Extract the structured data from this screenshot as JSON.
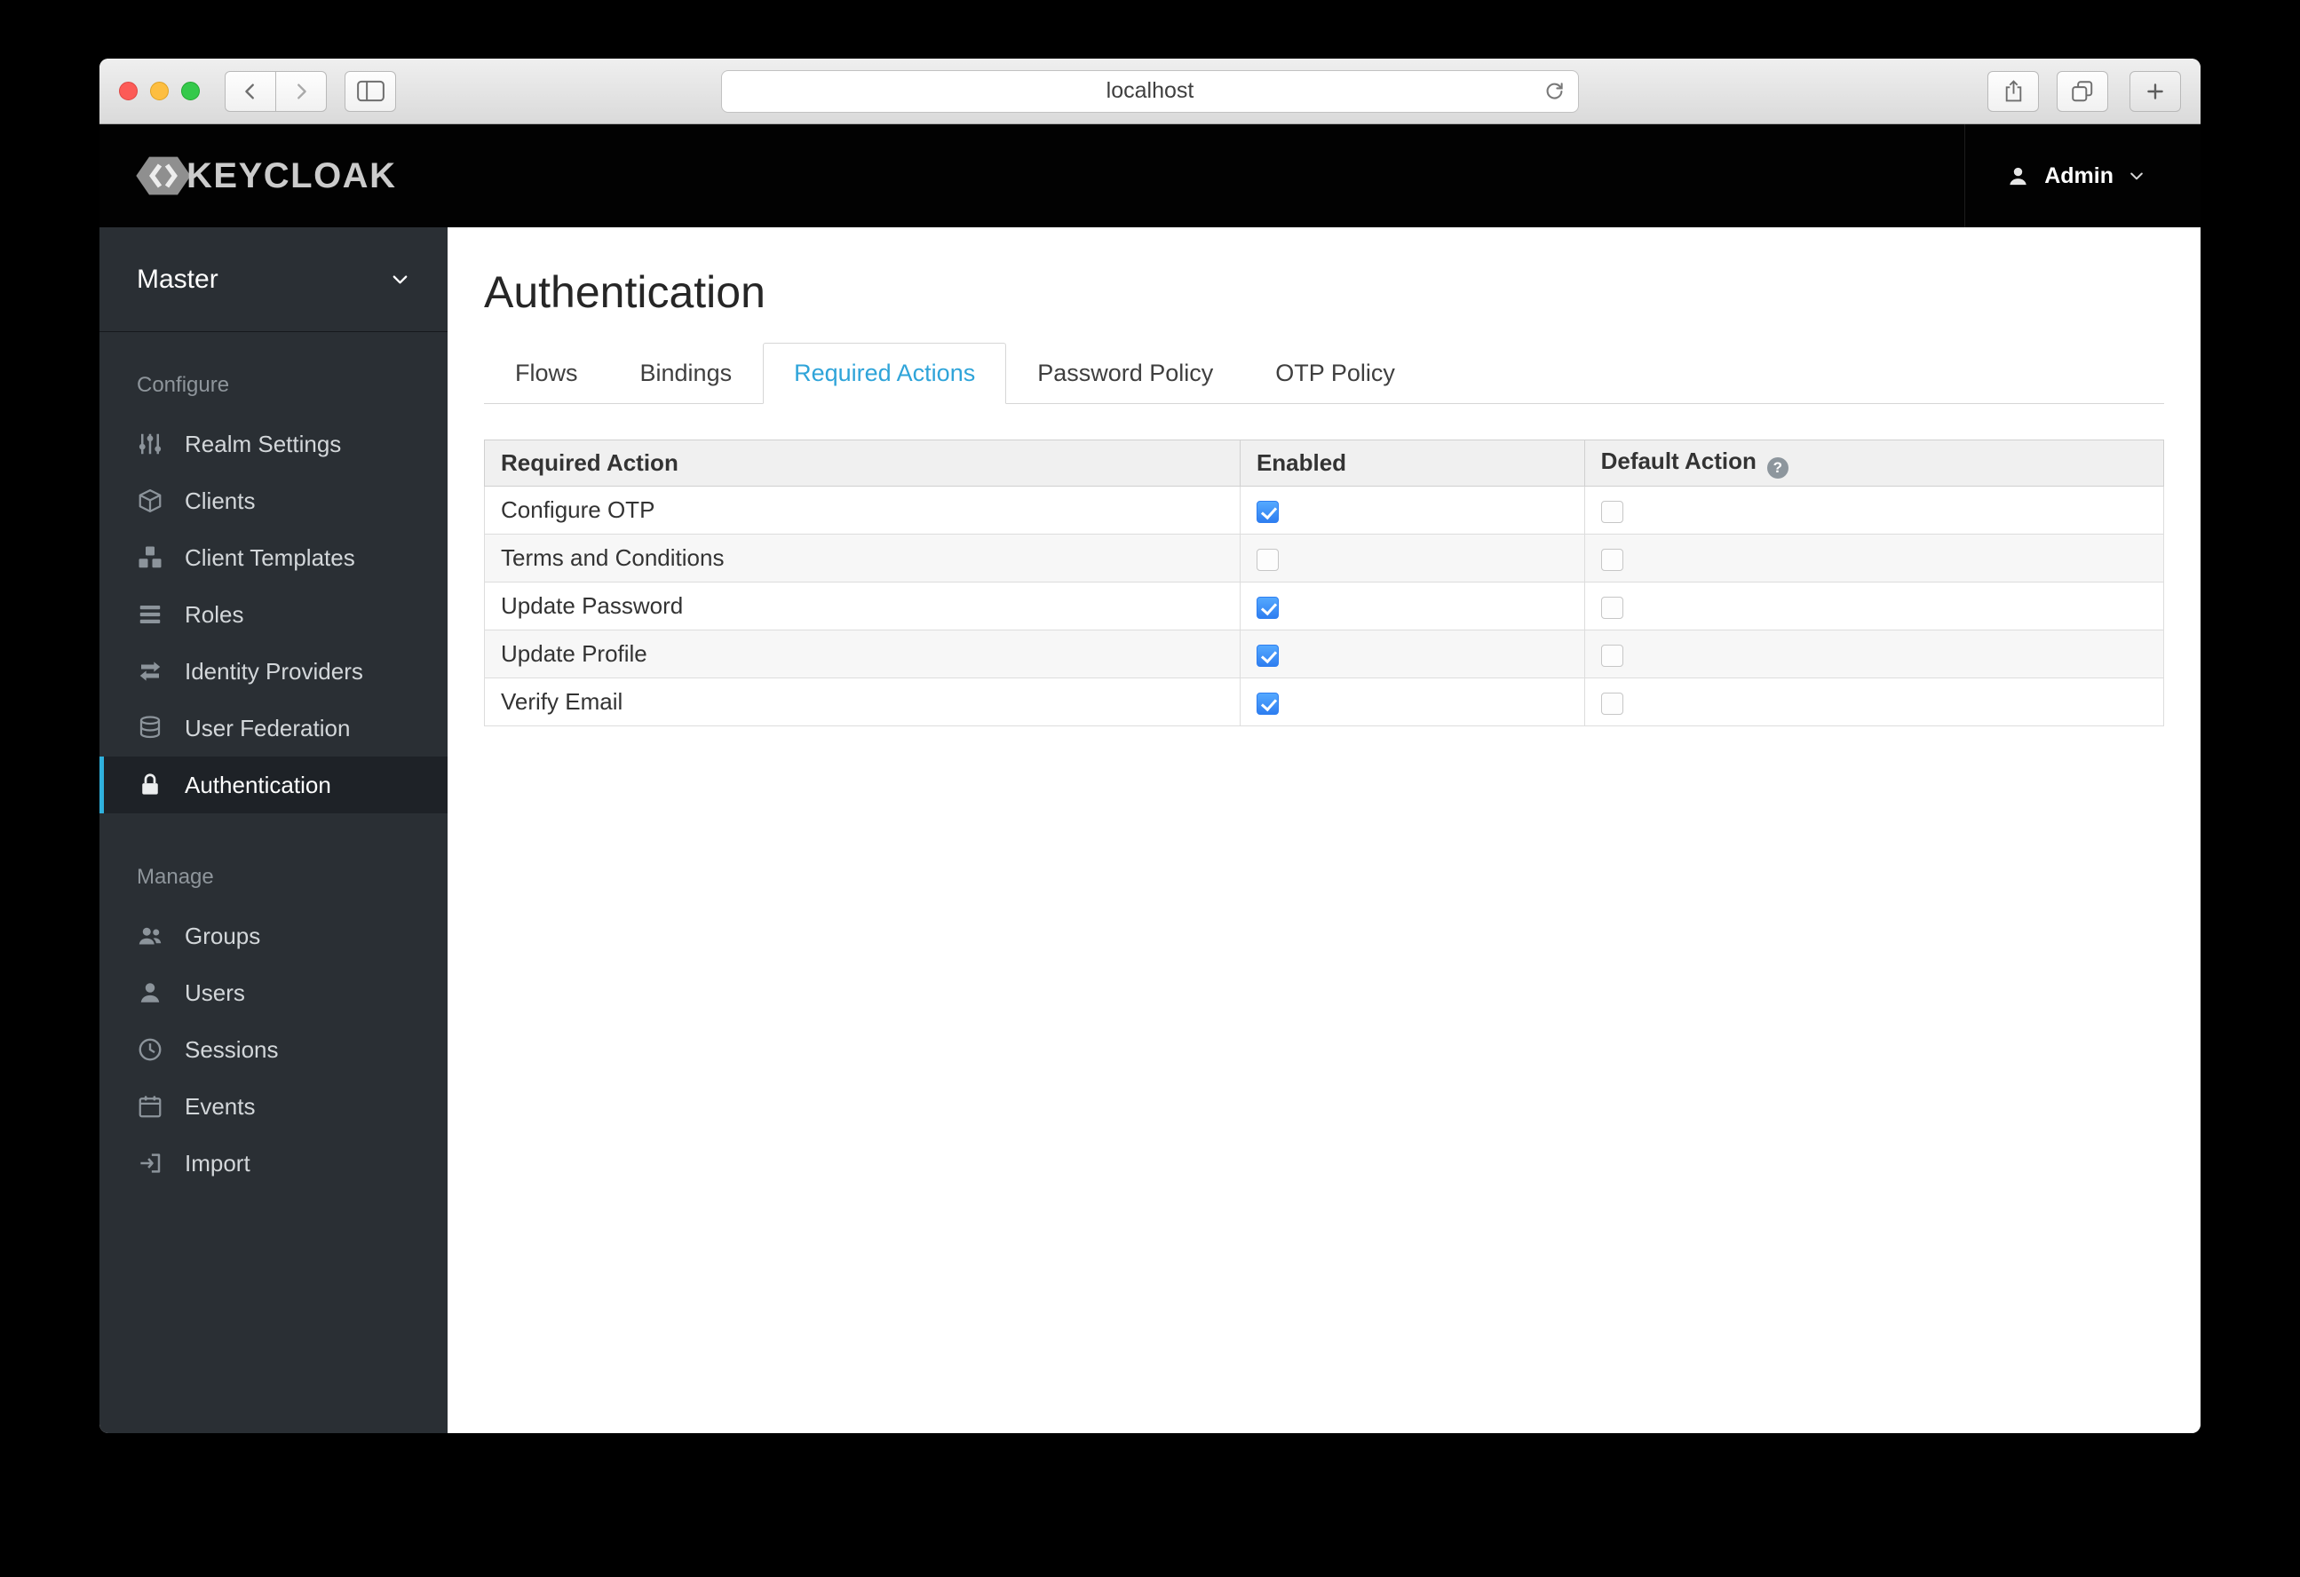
{
  "browser": {
    "address": "localhost"
  },
  "navbar": {
    "brand": "KEYCLOAK",
    "user": "Admin"
  },
  "sidebar": {
    "realm": "Master",
    "sections": [
      {
        "label": "Configure",
        "items": [
          {
            "label": "Realm Settings",
            "icon": "sliders-icon",
            "active": false
          },
          {
            "label": "Clients",
            "icon": "cube-icon",
            "active": false
          },
          {
            "label": "Client Templates",
            "icon": "cubes-icon",
            "active": false
          },
          {
            "label": "Roles",
            "icon": "list-icon",
            "active": false
          },
          {
            "label": "Identity Providers",
            "icon": "exchange-icon",
            "active": false
          },
          {
            "label": "User Federation",
            "icon": "database-icon",
            "active": false
          },
          {
            "label": "Authentication",
            "icon": "lock-icon",
            "active": true
          }
        ]
      },
      {
        "label": "Manage",
        "items": [
          {
            "label": "Groups",
            "icon": "groups-icon",
            "active": false
          },
          {
            "label": "Users",
            "icon": "user-icon",
            "active": false
          },
          {
            "label": "Sessions",
            "icon": "clock-icon",
            "active": false
          },
          {
            "label": "Events",
            "icon": "calendar-icon",
            "active": false
          },
          {
            "label": "Import",
            "icon": "import-icon",
            "active": false
          }
        ]
      }
    ]
  },
  "main": {
    "title": "Authentication",
    "tabs": [
      {
        "label": "Flows",
        "active": false
      },
      {
        "label": "Bindings",
        "active": false
      },
      {
        "label": "Required Actions",
        "active": true
      },
      {
        "label": "Password Policy",
        "active": false
      },
      {
        "label": "OTP Policy",
        "active": false
      }
    ],
    "table": {
      "columns": [
        "Required Action",
        "Enabled",
        "Default Action"
      ],
      "rows": [
        {
          "action": "Configure OTP",
          "enabled": true,
          "default_action": false
        },
        {
          "action": "Terms and Conditions",
          "enabled": false,
          "default_action": false
        },
        {
          "action": "Update Password",
          "enabled": true,
          "default_action": false
        },
        {
          "action": "Update Profile",
          "enabled": true,
          "default_action": false
        },
        {
          "action": "Verify Email",
          "enabled": true,
          "default_action": false
        }
      ]
    }
  },
  "colors": {
    "accent_blue": "#2fa4d9",
    "checkbox_blue": "#2e7ef0",
    "sidebar_bg": "#2a2f34",
    "active_item_border": "#2fb1dd",
    "navbar_bg": "#020202"
  }
}
